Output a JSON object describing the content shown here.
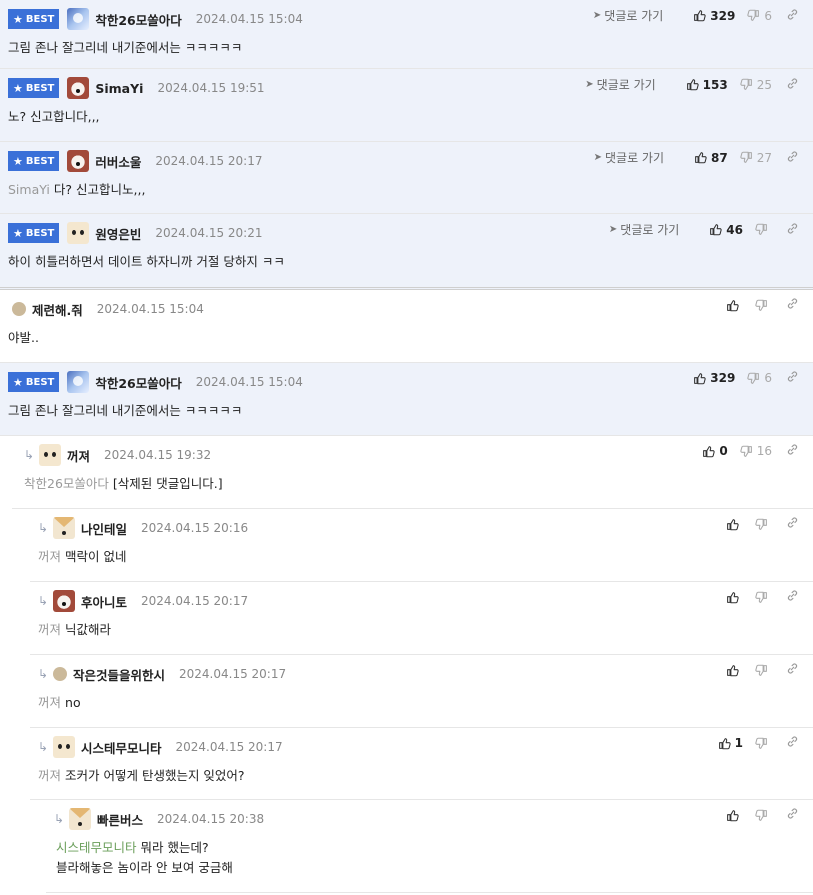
{
  "labels": {
    "best": "BEST",
    "goto_reply": "댓글로 가기"
  },
  "colors": {
    "best_badge": "#3a70d8",
    "best_row_bg": "#eef2fa",
    "ref_green": "#6a9e5a"
  },
  "comments": [
    {
      "best": true,
      "goto": true,
      "avatar": "av-blue",
      "nick": "착한26모쏠아다",
      "date": "2024.04.15 15:04",
      "ref": "",
      "text": "그림 존나 잘그리네 내기준에서는 ㅋㅋㅋㅋㅋ",
      "up": "329",
      "down": "6"
    },
    {
      "best": true,
      "goto": true,
      "avatar": "av-pet",
      "nick": "SimaYi",
      "date": "2024.04.15 19:51",
      "ref": "",
      "text": "노? 신고합니다,,,",
      "up": "153",
      "down": "25"
    },
    {
      "best": true,
      "goto": true,
      "avatar": "av-pet",
      "nick": "러버소울",
      "date": "2024.04.15 20:17",
      "ref": "SimaYi",
      "text": "다? 신고합니노,,,",
      "up": "87",
      "down": "27"
    },
    {
      "best": true,
      "goto": true,
      "avatar": "av-dog",
      "nick": "원영은빈",
      "date": "2024.04.15 20:21",
      "ref": "",
      "text": "하이 히틀러하면서 데이트 하자니까 거절 당하지 ㅋㅋ",
      "up": "46",
      "down": ""
    },
    {
      "best": false,
      "goto": false,
      "avatar": "av-bear",
      "nick": "제련해.줘",
      "date": "2024.04.15 15:04",
      "ref": "",
      "text": "야발..",
      "up": "",
      "down": ""
    },
    {
      "best": true,
      "goto": false,
      "avatar": "av-blue",
      "nick": "착한26모쏠아다",
      "date": "2024.04.15 15:04",
      "ref": "",
      "text": "그림 존나 잘그리네 내기준에서는 ㅋㅋㅋㅋㅋ",
      "up": "329",
      "down": "6"
    },
    {
      "best": false,
      "goto": false,
      "avatar": "av-dog",
      "nick": "꺼져",
      "date": "2024.04.15 19:32",
      "ref": "착한26모쏠아다",
      "text": "[삭제된 댓글입니다.]",
      "up": "0",
      "down": "16"
    },
    {
      "best": false,
      "goto": false,
      "avatar": "av-fox",
      "nick": "나인테일",
      "date": "2024.04.15 20:16",
      "ref": "꺼져",
      "text": "맥락이 없네",
      "up": "",
      "down": ""
    },
    {
      "best": false,
      "goto": false,
      "avatar": "av-pet",
      "nick": "후아니토",
      "date": "2024.04.15 20:17",
      "ref": "꺼져",
      "text": "닉값해라",
      "up": "",
      "down": ""
    },
    {
      "best": false,
      "goto": false,
      "avatar": "av-bear",
      "nick": "작은것들을위한시",
      "date": "2024.04.15 20:17",
      "ref": "꺼져",
      "text": "no",
      "up": "",
      "down": ""
    },
    {
      "best": false,
      "goto": false,
      "avatar": "av-dog",
      "nick": "시스테무모니타",
      "date": "2024.04.15 20:17",
      "ref": "꺼져",
      "text": "조커가 어떻게 탄생했는지 잊었어?",
      "up": "1",
      "down": ""
    },
    {
      "best": false,
      "goto": false,
      "avatar": "av-fox",
      "nick": "빠른버스",
      "date": "2024.04.15 20:38",
      "ref": "시스테무모니타",
      "text": "뭐라 했는데?",
      "text2": "블라해놓은 놈이라 안 보여 궁금해",
      "up": "",
      "down": ""
    }
  ]
}
